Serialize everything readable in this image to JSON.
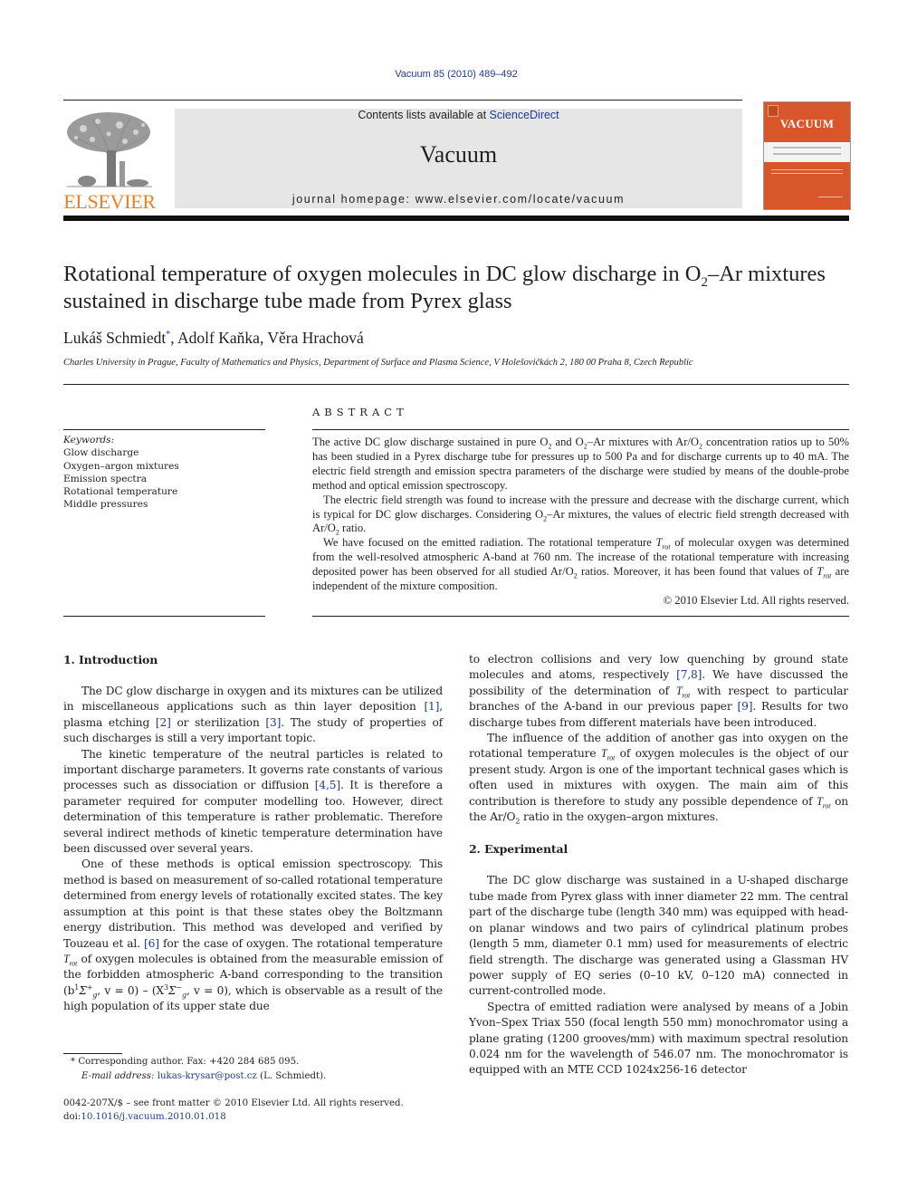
{
  "header": {
    "citation": "Vacuum 85 (2010) 489–492",
    "contents_prefix": "Contents lists available at ",
    "contents_link": "ScienceDirect",
    "journal_name": "Vacuum",
    "homepage": "journal homepage: www.elsevier.com/locate/vacuum",
    "publisher_logo_text": "ELSEVIER",
    "cover_title": "VACUUM",
    "colors": {
      "elsevier_orange": "#f07f1e",
      "cover_orange": "#d9562a",
      "link_blue": "#1f3a93",
      "banner_gray": "#e6e6e6"
    }
  },
  "article": {
    "title_part1": "Rotational temperature of oxygen molecules in DC glow discharge in O",
    "title_sub": "2",
    "title_part2": "–Ar mixtures sustained in discharge tube made from Pyrex glass",
    "authors": [
      {
        "name": "Lukáš Schmiedt",
        "mark": "*"
      },
      {
        "name": "Adolf Kaňka",
        "mark": ""
      },
      {
        "name": "Věra Hrachová",
        "mark": ""
      }
    ],
    "affiliation": "Charles University in Prague, Faculty of Mathematics and Physics, Department of Surface and Plasma Science, V Holešovičkách 2, 180 00 Praha 8, Czech Republic"
  },
  "keywords": {
    "label": "Keywords:",
    "items": [
      "Glow discharge",
      "Oxygen–argon mixtures",
      "Emission spectra",
      "Rotational temperature",
      "Middle pressures"
    ]
  },
  "abstract": {
    "heading": "ABSTRACT",
    "p1": {
      "a": "The active DC glow discharge sustained in pure O",
      "b": " and O",
      "c": "–Ar mixtures with Ar/O",
      "d": " concentration ratios up to 50% has been studied in a Pyrex discharge tube for pressures up to 500 Pa and for discharge currents up to 40 mA. The electric field strength and emission spectra parameters of the discharge were studied by means of the double-probe method and optical emission spectroscopy."
    },
    "p2": {
      "a": "The electric field strength was found to increase with the pressure and decrease with the discharge current, which is typical for DC glow discharges. Considering O",
      "b": "–Ar mixtures, the values of electric field strength decreased with Ar/O",
      "c": " ratio."
    },
    "p3": {
      "a": "We have focused on the emitted radiation. The rotational temperature ",
      "b": " of molecular oxygen was determined from the well-resolved atmospheric A-band at 760 nm. The increase of the rotational temperature with increasing deposited power has been observed for all studied Ar/O",
      "c": " ratios. Moreover, it has been found that values of ",
      "d": " are independent of the mixture composition."
    },
    "copyright": "© 2010 Elsevier Ltd. All rights reserved."
  },
  "symbols": {
    "T": "T",
    "rot": "rot",
    "two": "2"
  },
  "intro": {
    "heading": "1.  Introduction",
    "p1": {
      "a": "The DC glow discharge in oxygen and its mixtures can be utilized in miscellaneous applications such as thin layer deposition ",
      "r1": "[1]",
      "b": ", plasma etching ",
      "r2": "[2]",
      "c": " or sterilization ",
      "r3": "[3]",
      "d": ". The study of properties of such discharges is still a very important topic."
    },
    "p2": {
      "a": "The kinetic temperature of the neutral particles is related to important discharge parameters. It governs rate constants of various processes such as dissociation or diffusion ",
      "r1": "[4,5]",
      "b": ". It is therefore a parameter required for computer modelling too. However, direct determination of this temperature is rather problematic. Therefore several indirect methods of kinetic temperature determination have been discussed over several years."
    },
    "p3": {
      "a": "One of these methods is optical emission spectroscopy. This method is based on measurement of so-called rotational temperature determined from energy levels of rotationally excited states. The key assumption at this point is that these states obey the Boltzmann energy distribution. This method was developed and verified by Touzeau et al. ",
      "r1": "[6]",
      "b": " for the case of oxygen. The rotational temperature ",
      "c": " of oxygen molecules is obtained from the measurable emission of the forbidden atmospheric A-band corresponding to the transition (b",
      "d": ", v = 0) – (X",
      "e": ", v = 0), which is observable as a result of the high population of its upper state due"
    },
    "p4": {
      "a": "to electron collisions and very low quenching by ground state molecules and atoms, respectively ",
      "r1": "[7,8]",
      "b": ". We have discussed the possibility of the determination of ",
      "c": " with respect to particular branches of the A-band in our previous paper ",
      "r2": "[9]",
      "d": ". Results for two discharge tubes from different materials have been introduced."
    },
    "p5": {
      "a": "The influence of the addition of another gas into oxygen on the rotational temperature ",
      "b": " of oxygen molecules is the object of our present study. Argon is one of the important technical gases which is often used in mixtures with oxygen. The main aim of this contribution is therefore to study any possible dependence of ",
      "c": " on the Ar/O",
      "d": " ratio in the oxygen–argon mixtures."
    }
  },
  "experimental": {
    "heading": "2.  Experimental",
    "p1": "The DC glow discharge was sustained in a U-shaped discharge tube made from Pyrex glass with inner diameter 22 mm. The central part of the discharge tube (length 340 mm) was equipped with head-on planar windows and two pairs of cylindrical platinum probes (length 5 mm, diameter 0.1 mm) used for measurements of electric field strength. The discharge was generated using a Glassman HV power supply of EQ series (0–10 kV, 0–120 mA) connected in current-controlled mode.",
    "p2": "Spectra of emitted radiation were analysed by means of a Jobin Yvon–Spex Triax 550 (focal length 550 mm) monochromator using a plane grating (1200 grooves/mm) with maximum spectral resolution 0.024 nm for the wavelength of 546.07 nm. The monochromator is equipped with an MTE CCD 1024x256-16 detector"
  },
  "footnote": {
    "mark": "*",
    "corresponding": " Corresponding author. Fax: +420 284 685 095.",
    "email_label": "E-mail address: ",
    "email": "lukas-krysar@post.cz",
    "email_suffix": " (L. Schmiedt)."
  },
  "front_matter": {
    "issn_line": "0042-207X/$ – see front matter © 2010 Elsevier Ltd. All rights reserved.",
    "doi_label": "doi:",
    "doi": "10.1016/j.vacuum.2010.01.018"
  }
}
